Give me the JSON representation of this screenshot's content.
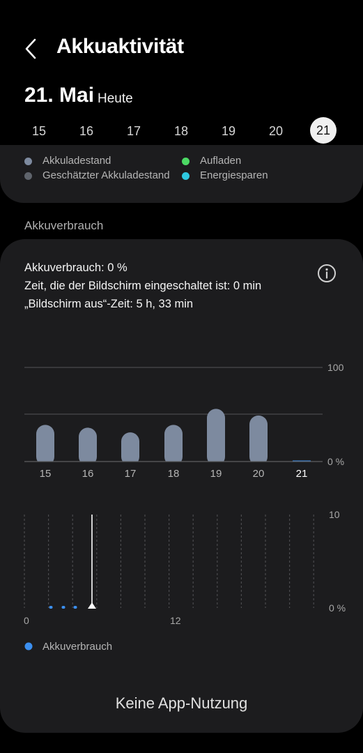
{
  "header": {
    "title": "Akkuaktivität"
  },
  "date": {
    "main": "21. Mai",
    "sub": "Heute"
  },
  "days": [
    "15",
    "16",
    "17",
    "18",
    "19",
    "20",
    "21"
  ],
  "selected_day": "21",
  "legend": {
    "battery_level": "Akkuladestand",
    "estimated_level": "Geschätzter Akkuladestand",
    "charging": "Aufladen",
    "power_saving": "Energiesparen"
  },
  "section_label": "Akkuverbrauch",
  "usage": {
    "line1": "Akkuverbrauch: 0 %",
    "line2": "Zeit, die der Bildschirm eingeschaltet ist: 0 min",
    "line3": "„Bildschirm aus“-Zeit: 5 h, 33 min"
  },
  "colors": {
    "bar": "#7d8a9f",
    "accent_blue": "#3b8ff0",
    "charging_green": "#4cd964",
    "power_saving_cyan": "#2ec8e0"
  },
  "icons": {
    "back": "chevron-left-icon",
    "info": "info-circle-icon"
  },
  "chart_data": [
    {
      "type": "bar",
      "categories": [
        "15",
        "16",
        "17",
        "18",
        "19",
        "20",
        "21"
      ],
      "values": [
        39,
        36,
        31,
        39,
        56,
        49,
        0
      ],
      "ylim": [
        0,
        100
      ],
      "yticks": [
        "100",
        "0 %"
      ]
    },
    {
      "type": "bar",
      "x": [
        "0",
        "1",
        "2"
      ],
      "values": [
        0,
        0,
        0
      ],
      "ylim": [
        0,
        10
      ],
      "yticks": [
        "10",
        "0 %"
      ],
      "xticks": [
        "0",
        "12"
      ],
      "legend": [
        "Akkuverbrauch"
      ]
    }
  ],
  "legend2": "Akkuverbrauch",
  "no_app": "Keine App-Nutzung"
}
